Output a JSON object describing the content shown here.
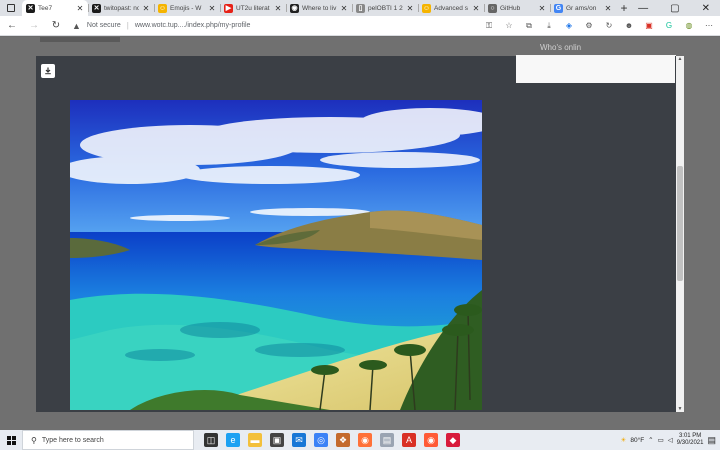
{
  "browser": {
    "tabs": [
      {
        "title": "Tee7",
        "favicon_color": "#1a1a1a",
        "favicon_glyph": "✕",
        "active": true
      },
      {
        "title": "twitopast: no",
        "favicon_color": "#1a1a1a",
        "favicon_glyph": "✕",
        "active": false
      },
      {
        "title": "Emojis - W",
        "favicon_color": "#f5b400",
        "favicon_glyph": "☺",
        "active": false
      },
      {
        "title": "UT2u literat",
        "favicon_color": "#e62117",
        "favicon_glyph": "▶",
        "active": false
      },
      {
        "title": "Where to liv",
        "favicon_color": "#222222",
        "favicon_glyph": "◉",
        "active": false
      },
      {
        "title": "pelOBTI 1 2",
        "favicon_color": "#888888",
        "favicon_glyph": "▯",
        "active": false
      },
      {
        "title": "Advanced s",
        "favicon_color": "#f5b400",
        "favicon_glyph": "☺",
        "active": false
      },
      {
        "title": "GitHub",
        "favicon_color": "#666666",
        "favicon_glyph": "○",
        "active": false
      },
      {
        "title": "Gr ams/on",
        "favicon_color": "#4285f4",
        "favicon_glyph": "G",
        "active": false
      }
    ],
    "new_tab_glyph": "+",
    "window_controls": [
      "—",
      "▢",
      "✕"
    ],
    "security_label": "Not secure",
    "url": "www.wotc.tup..../index.php/my-profile",
    "toolbar_icons": [
      "key-icon",
      "star-icon",
      "extensions-icon",
      "download-icon",
      "shield-icon",
      "settings-icon",
      "refresh-icon",
      "profile-icon",
      "pdf-icon",
      "grammarly-icon",
      "avatar-icon",
      "more-icon"
    ]
  },
  "page": {
    "sidebar_heading": "Who's onlin"
  },
  "modal": {
    "download_icon": "download-icon",
    "photo": {
      "subject": "tropical bay beach",
      "sky_top": "#1d2fbd",
      "sky_mid": "#2a6ae0",
      "sea_deep": "#0b58d8",
      "lagoon": "#23c7c7",
      "sand": "#e8df8a",
      "hills": "#8a7d45"
    }
  },
  "taskbar": {
    "search_placeholder": "Type here to search",
    "time": "3:01 PM",
    "date": "9/30/2021",
    "weather": "80°F",
    "apps": [
      {
        "name": "task-view-icon",
        "color": "#333333",
        "glyph": "◫"
      },
      {
        "name": "edge-icon",
        "color": "#1da1f2",
        "glyph": "e"
      },
      {
        "name": "file-explorer-icon",
        "color": "#f3c03b",
        "glyph": "▬"
      },
      {
        "name": "store-icon",
        "color": "#444444",
        "glyph": "▣"
      },
      {
        "name": "mail-icon",
        "color": "#1877d6",
        "glyph": "✉"
      },
      {
        "name": "chrome-icon",
        "color": "#3b82f6",
        "glyph": "◎"
      },
      {
        "name": "app-icon",
        "color": "#c46a2c",
        "glyph": "❖"
      },
      {
        "name": "firefox-icon",
        "color": "#ff7139",
        "glyph": "◉"
      },
      {
        "name": "folder-icon",
        "color": "#9aa4b2",
        "glyph": "▤"
      },
      {
        "name": "acrobat-icon",
        "color": "#d93025",
        "glyph": "A"
      },
      {
        "name": "firefox-alt-icon",
        "color": "#ff5a36",
        "glyph": "◉"
      },
      {
        "name": "red-app-icon",
        "color": "#d81b3c",
        "glyph": "◆"
      }
    ]
  }
}
